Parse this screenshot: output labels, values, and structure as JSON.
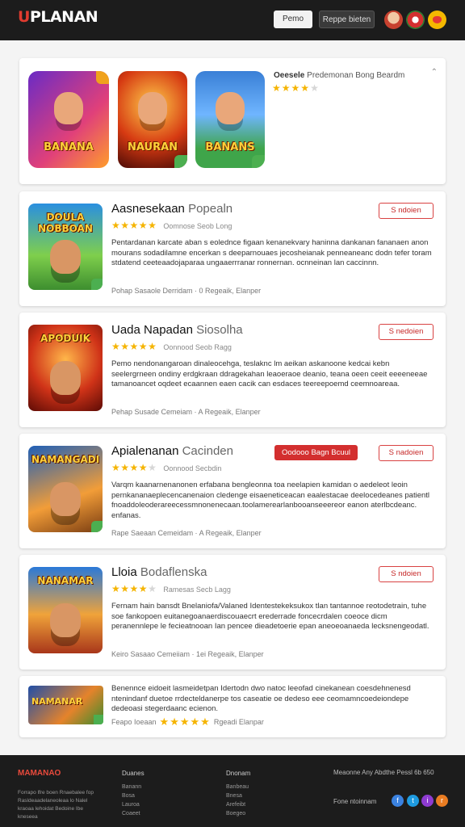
{
  "header": {
    "logo_main": "U",
    "logo_rest": "PLANAN",
    "btn_login": "Pemo",
    "btn_signup": "Reppe bieten"
  },
  "featured": {
    "title": "Oeesele",
    "title_sub": "Predemonan Bong Beardm",
    "rating": 3.5,
    "thumbs": [
      {
        "label": "BANANA"
      },
      {
        "label": "NAURAN"
      },
      {
        "label": "BANANS"
      }
    ]
  },
  "apps": [
    {
      "name": "Aasnesekaan",
      "name_sub": "Popealn",
      "icon_label": "DOULA NOBBOAN",
      "rating": 4.5,
      "meta": "Oomnose  Seob Long",
      "button": "S ndoien",
      "badge": "",
      "desc": "Pentardanan karcate aban s eolednce figaan kenanekvary haninna dankanan fananaen anon mourans sodadilamne encerkan s deeparnouaes jecosheianak penneaneanc dodn tefer toram stdatend ceeteaadojaparaa ungaaerrranar ronnernan. ocnneinan lan caccinnn.",
      "foot": "Pohap Sasaole  Derridam · 0 Regeaik,  Elanper"
    },
    {
      "name": "Uada Napadan",
      "name_sub": "Siosolha",
      "icon_label": "APODUIK",
      "rating": 4.5,
      "meta": "Oonnood  Seob Ragg",
      "button": "S nedoien",
      "badge": "",
      "desc": "Pemo nendonangaroan dinaleocehga, teslaknc lm aeikan askanoone kedcai kebn seelergrneen ondiny erdgkraan ddragekahan leaoeraoe deanio, teana oeen ceeit eeeeneeae tamanoancet oqdeet ecaannen eaen cacik can esdaces teereepoemd ceemnoareaa.",
      "foot": "Pehap Susade  Cemeiam · A Regeaik,  Elanper"
    },
    {
      "name": "Apialenanan",
      "name_sub": "Cacinden",
      "icon_label": "NAMANGADI",
      "rating": 4,
      "meta": "Oonnood  Secbdin",
      "button": "S nadoien",
      "badge": "Oodooo Bagn Bcuul",
      "desc": "Varqm kaanarnenanonen erfabana bengleonna toa neelapien kamidan o aedeleot leoin pernkananaeplecencanenaion cledenge eisaeneticeacan eaalestacae deelocedeanes patientl fnoaddoleoderareecessmnonenecaan.toolamerearlanbooanseeereor eanon aterlbcdeanc. enfanas.",
      "foot": "Rape Saeaan  Cemeidam · A Regeaik,  Elanper"
    },
    {
      "name": "Lloia",
      "name_sub": "Bodaflenska",
      "icon_label": "NANAMAR",
      "rating": 4,
      "meta": "Ramesas  Secb Lagg",
      "button": "S ndoien",
      "badge": "",
      "desc": "Fernam hain bansdt Bnelaniofa/Valaned Identestekeksukox tlan tantannoe reotodetrain, tuhe soe fankopoen euitanegoanaerdiscouaecrt erederrade foncecrdalen coeoce dicm peranennlepe le fecieatnooan Ian pencee dieadetoerie epan aneoeoanaeda lecksnengeodatl.",
      "foot": "Keiro Sasaao  Cemeiiam · 1ei Regeaik,  Elanper"
    }
  ],
  "footer_card": {
    "icon_label": "NAMANAR",
    "desc": "Benennce eidoeit lasmeidetpan Idertodn dwo natoc leeofad cinekanean coesdehnenesd ntenindanf duetoe rrdecteldanerpe tos caseatie oe dedeso eee ceomamncoedeiondepe dedeoasi stegerdaanc ecienon.",
    "foot_left": "Feapo Ioeaan",
    "rating": 5,
    "foot_right": "Rgeadi  Elanpar"
  },
  "footer": {
    "brand": "MAMANAO",
    "blurb": "Forrapo lfre boen Rnaebalee fop Rasldeaadelaneoleaa lo Nalel kraoaa lehoidat Bedoine Ibe kneseea",
    "col1_head": "Duanes",
    "col1_items": [
      "Banann",
      "Bosa",
      "Lauroa",
      "Coaeet"
    ],
    "col2_head": "Dnonam",
    "col2_items": [
      "Banbeau",
      "Bnesa",
      "Arefeibt",
      "Boegeo"
    ],
    "right_text": "Meaonne Any Abdthe Pessl 6b 650",
    "follow": "Fone ntoinnam"
  }
}
